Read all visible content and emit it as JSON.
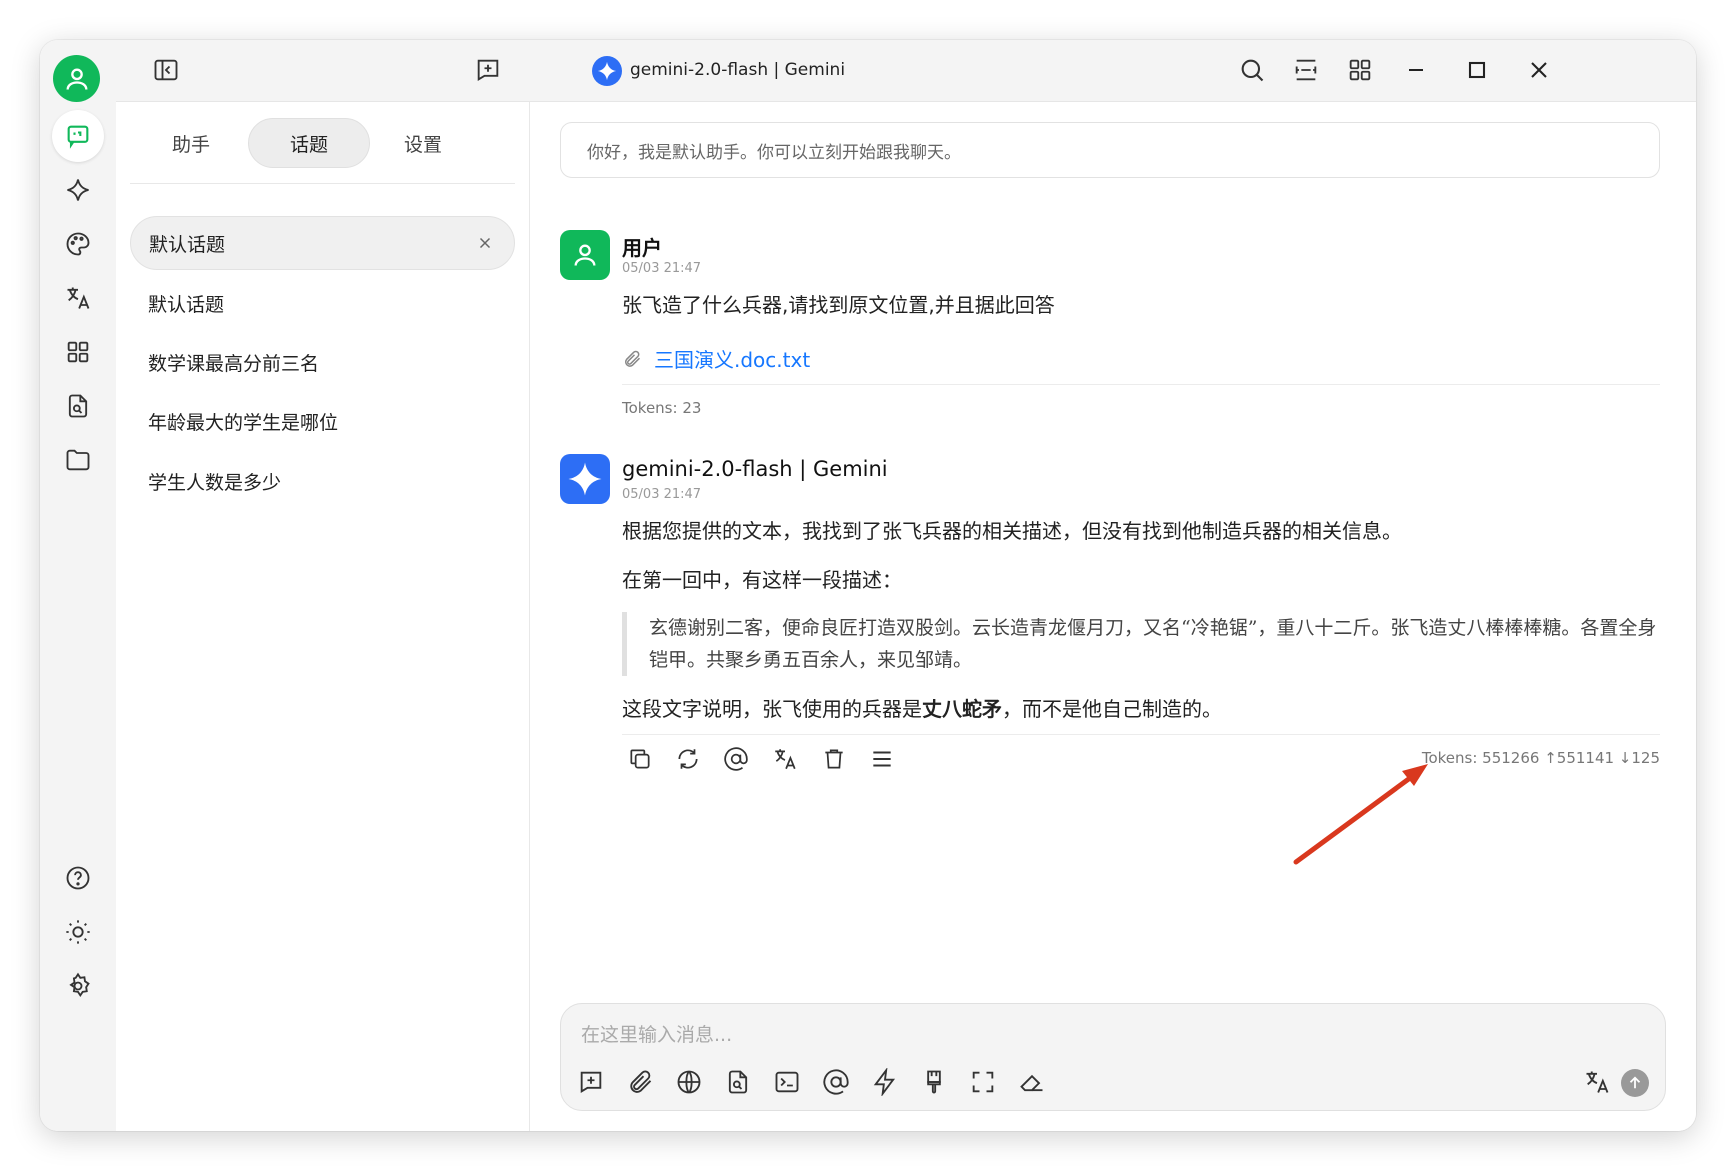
{
  "header": {
    "model_title": "gemini-2.0-flash | Gemini"
  },
  "topic_panel": {
    "tabs": [
      {
        "label": "助手"
      },
      {
        "label": "话题"
      },
      {
        "label": "设置"
      }
    ],
    "active_tab": "话题",
    "topics": [
      {
        "label": "默认话题"
      },
      {
        "label": "默认话题"
      },
      {
        "label": "数学课最高分前三名"
      },
      {
        "label": "年龄最大的学生是哪位"
      },
      {
        "label": "学生人数是多少"
      }
    ]
  },
  "chat": {
    "welcome": "你好，我是默认助手。你可以立刻开始跟我聊天。",
    "user_message": {
      "name": "用户",
      "time": "05/03 21:47",
      "text": "张飞造了什么兵器,请找到原文位置,并且据此回答",
      "attachment": "三国演义.doc.txt",
      "tokens": "Tokens: 23"
    },
    "assistant_message": {
      "name": "gemini-2.0-flash | Gemini",
      "time": "05/03 21:47",
      "para1": "根据您提供的文本，我找到了张飞兵器的相关描述，但没有找到他制造兵器的相关信息。",
      "para2": "在第一回中，有这样一段描述：",
      "quote": "玄德谢别二客，便命良匠打造双股剑。云长造青龙偃月刀，又名“冷艳锯”，重八十二斤。张飞造丈八棒棒棒糖。各置全身铠甲。共聚乡勇五百余人，来见邹靖。",
      "para3_before": "这段文字说明，张飞使用的兵器是",
      "para3_bold": "丈八蛇矛",
      "para3_after": "，而不是他自己制造的。",
      "tokens": "Tokens: 551266 ↑551141 ↓125"
    }
  },
  "input": {
    "placeholder": "在这里输入消息..."
  },
  "colors": {
    "accent_green": "#10b85a",
    "gemini_blue": "#2d6ef5",
    "link_blue": "#1677ff",
    "annotation_arrow": "#d9381e"
  }
}
